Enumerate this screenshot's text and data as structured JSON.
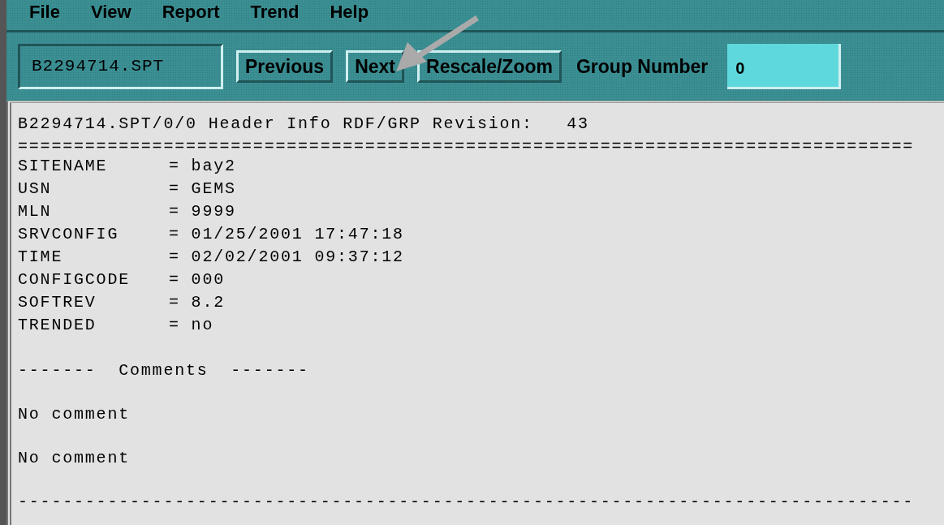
{
  "menu_bar": [
    "File",
    "View",
    "Report",
    "Trend",
    "Help"
  ],
  "toolbar": {
    "file_field": {
      "value": "B2294714.SPT"
    },
    "buttons": [
      "Previous",
      "Next",
      "Rescale/Zoom"
    ],
    "group_label": "Group Number",
    "group_field": {
      "value": "0"
    }
  },
  "report": {
    "header": "B2294714.SPT/0/0 Header Info RDF/GRP Revision:   43",
    "rule": "================================================================================",
    "fields": [
      {
        "key": "SITENAME",
        "value": "= bay2"
      },
      {
        "key": "USN",
        "value": "= GEMS"
      },
      {
        "key": "MLN",
        "value": "= 9999"
      },
      {
        "key": "SRVCONFIG",
        "value": "= 01/25/2001 17:47:18"
      },
      {
        "key": "TIME",
        "value": "= 02/02/2001 09:37:12"
      },
      {
        "key": "CONFIGCODE",
        "value": "= 000"
      },
      {
        "key": "SOFTREV",
        "value": "= 8.2"
      },
      {
        "key": "TRENDED",
        "value": "= no"
      }
    ],
    "comments_heading": "-------  Comments  -------",
    "comments": [
      "No comment",
      "No comment"
    ],
    "bottom_rule": "--------------------------------------------------------------------------------"
  }
}
